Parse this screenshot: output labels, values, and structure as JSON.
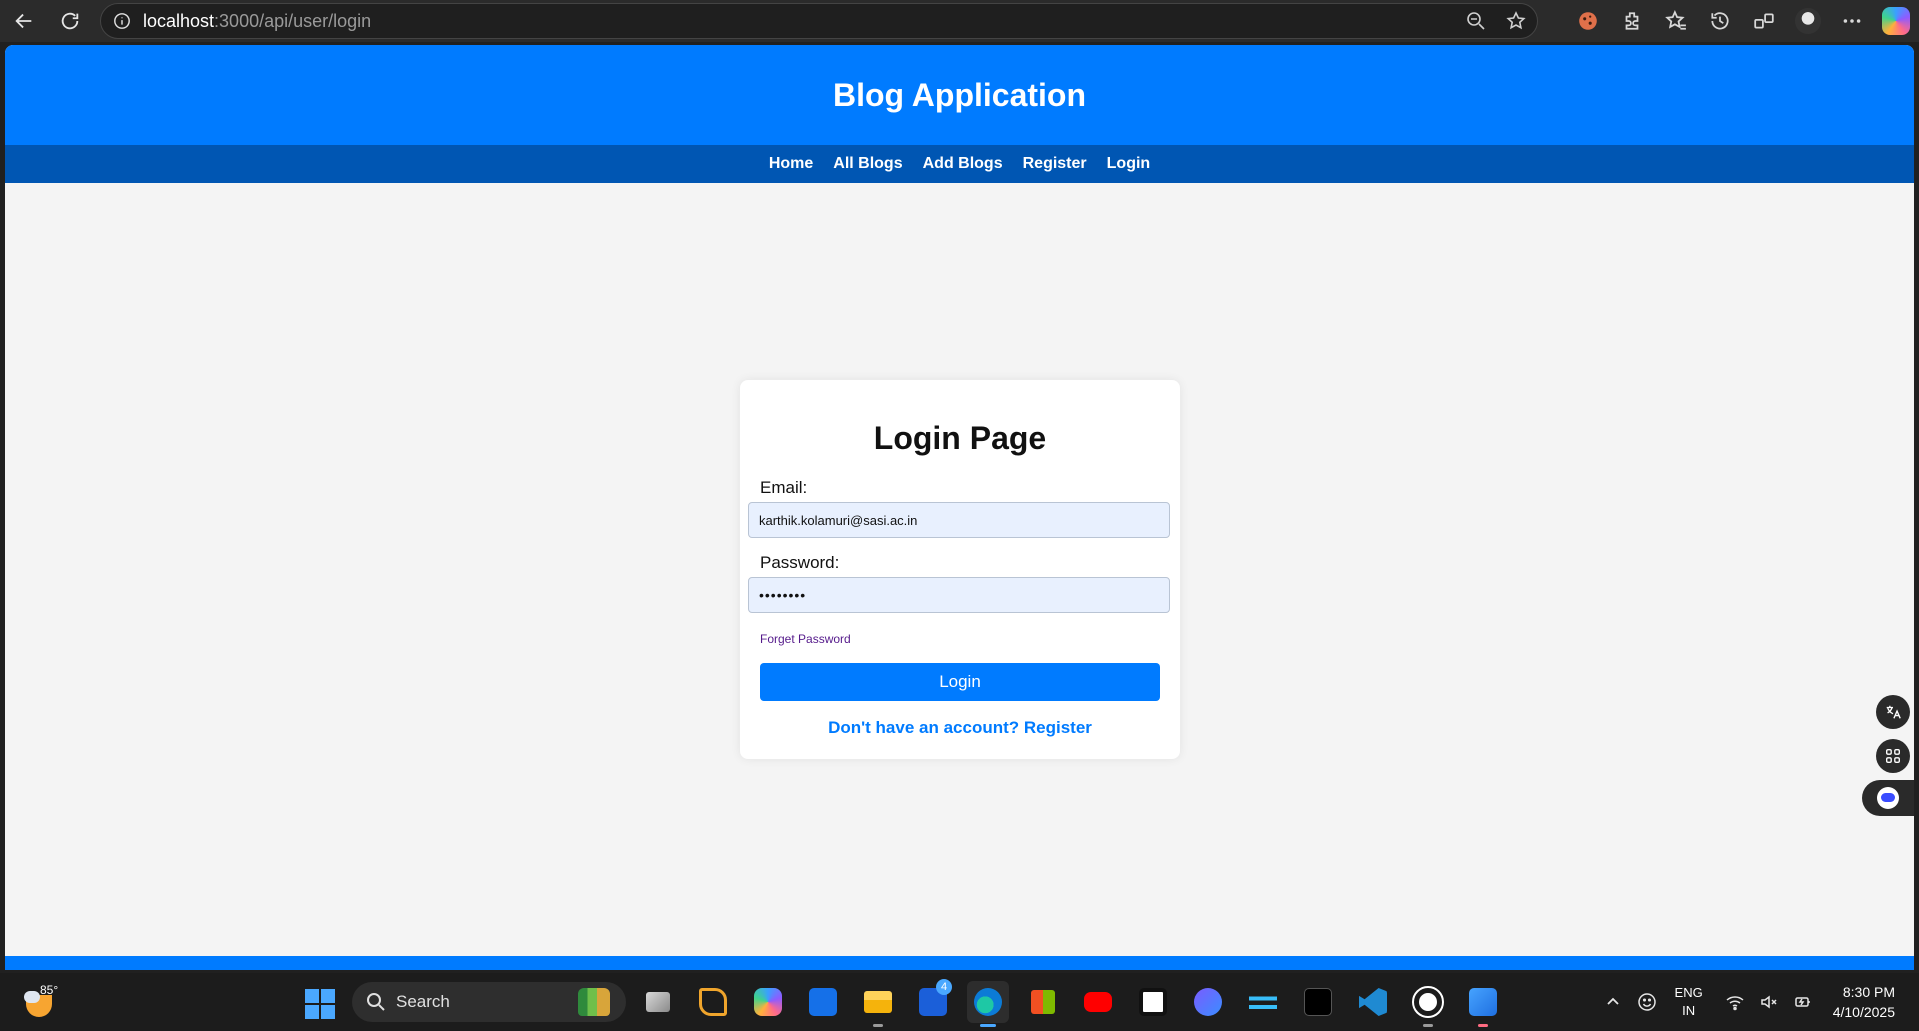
{
  "browser": {
    "url_host": "localhost",
    "url_path": ":3000/api/user/login"
  },
  "site": {
    "title": "Blog Application",
    "nav": [
      "Home",
      "All Blogs",
      "Add Blogs",
      "Register",
      "Login"
    ]
  },
  "login": {
    "title": "Login Page",
    "email_label": "Email:",
    "email_value": "karthik.kolamuri@sasi.ac.in",
    "password_label": "Password:",
    "password_mask": "••••••••",
    "forget_link": "Forget Password",
    "submit_label": "Login",
    "register_link": "Don't have an account? Register"
  },
  "taskbar": {
    "weather_temp": "85°",
    "search_label": "Search",
    "mail_badge": "4",
    "lang_top": "ENG",
    "lang_bottom": "IN",
    "time": "8:30 PM",
    "date": "4/10/2025"
  },
  "colors": {
    "primary": "#007bff",
    "nav_bg": "#0056b3",
    "page_bg": "#f4f4f4",
    "input_bg": "#e8f0fe"
  }
}
